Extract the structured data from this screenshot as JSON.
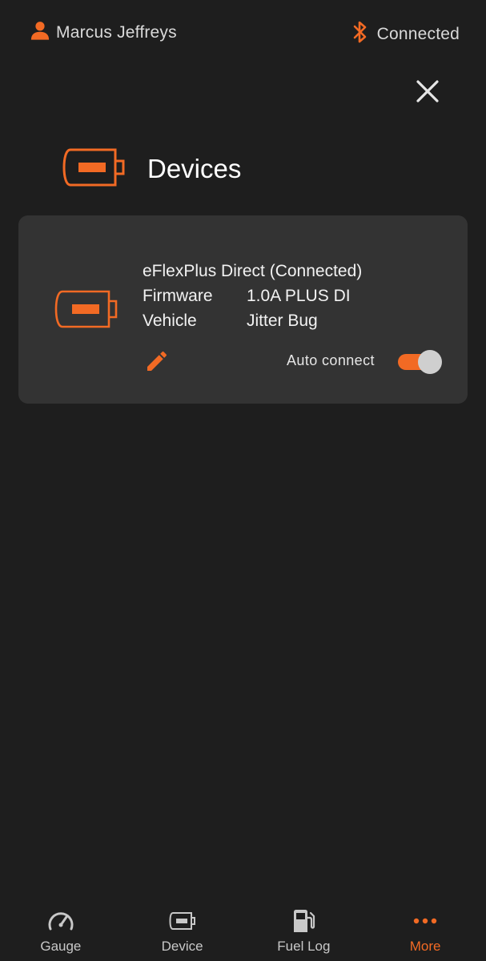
{
  "status_bar": {
    "user_name": "Marcus Jeffreys",
    "connection_status": "Connected"
  },
  "header": {
    "title": "Devices"
  },
  "device_card": {
    "name": "eFlexPlus Direct (Connected)",
    "rows": [
      {
        "key": "Firmware",
        "value": "1.0A PLUS DI"
      },
      {
        "key": "Vehicle",
        "value": "Jitter Bug"
      }
    ],
    "auto_connect_label": "Auto connect",
    "auto_connect_enabled": true
  },
  "bottom_nav": {
    "items": [
      {
        "label": "Gauge",
        "icon": "gauge-icon",
        "active": false
      },
      {
        "label": "Device",
        "icon": "device-icon",
        "active": false
      },
      {
        "label": "Fuel Log",
        "icon": "fuel-pump-icon",
        "active": false
      },
      {
        "label": "More",
        "icon": "more-dots-icon",
        "active": true
      }
    ]
  },
  "colors": {
    "accent": "#f26a24",
    "background": "#1e1e1e",
    "card": "#333333"
  }
}
